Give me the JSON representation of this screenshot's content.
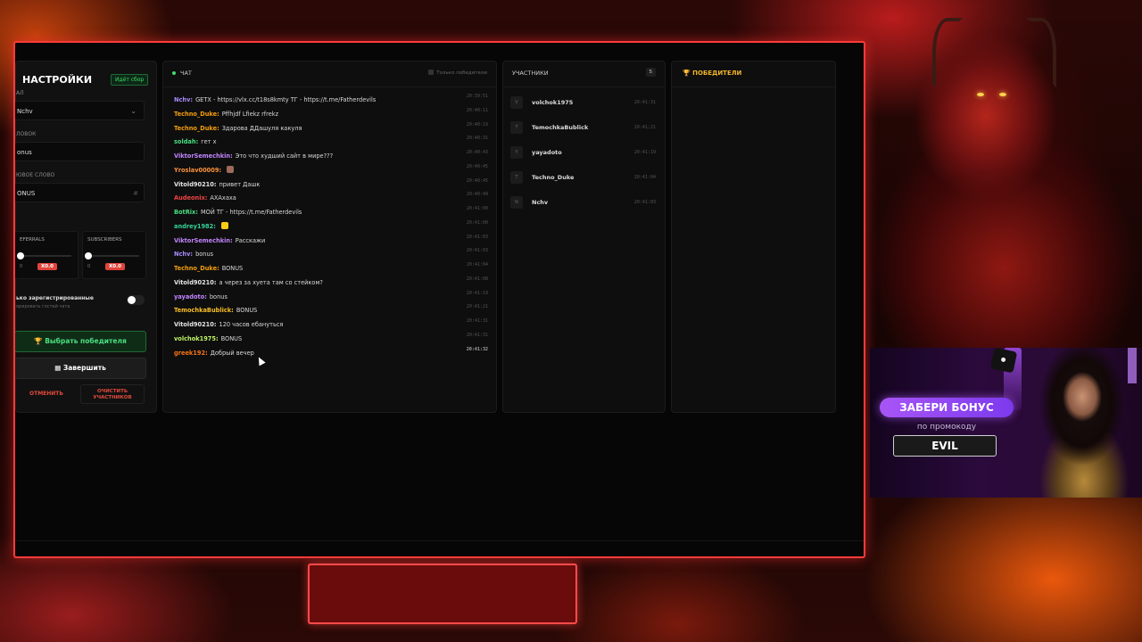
{
  "settings": {
    "title": "НАСТРОЙКИ",
    "collect_badge": "Идёт сбор",
    "channel_label": "АЛ",
    "channel_value": "Nchv",
    "heading_label": "ЛОВОК",
    "heading_value": "onus",
    "keyword_label": "ЮВОЕ СЛОВО",
    "keyword_value": "ONUS",
    "referrals_label": "EFERRALS",
    "referrals_multiplier": "X0.0",
    "subscribers_label": "SUBSCRIBERS",
    "subscribers_multiplier": "X0.0",
    "slider_min": "0",
    "registered_only_label": "ько зарегистрированные",
    "registered_only_sub": "орировать гостей чата",
    "registered_only_on": false,
    "pick_winner_label": "Выбрать победителя",
    "finish_label": "Завершить",
    "cancel_label": "ОТМЕНИТЬ",
    "clear_label": "ОЧИСТИТЬ УЧАСТНИКОВ"
  },
  "chat": {
    "title": "ЧАТ",
    "winners_only_label": "Только победители",
    "messages": [
      {
        "user": "Nchv:",
        "text": "GETX - https://vlx.cc/t18s8kmty ТГ - https://t.me/Fatherdevils",
        "time": "20:39:51",
        "color": "#a78bfa"
      },
      {
        "user": "Techno_Duke:",
        "text": "Pffhjdf Lfiekz rfrekz",
        "time": "20:40:11",
        "color": "#f59e0b"
      },
      {
        "user": "Techno_Duke:",
        "text": "Здарова ДДашуля какуля",
        "time": "20:40:19",
        "color": "#f59e0b"
      },
      {
        "user": "soldah:",
        "text": "гет х",
        "time": "20:40:31",
        "color": "#4ade80"
      },
      {
        "user": "ViktorSemechkin:",
        "text": "Это что худший сайт в мире???",
        "time": "20:40:43",
        "color": "#c084fc"
      },
      {
        "user": "Yroslav00009:",
        "text": "",
        "time": "20:40:45",
        "color": "#fb923c",
        "emoji": true
      },
      {
        "user": "Vitold90210:",
        "text": "привет Дашк",
        "time": "20:40:45",
        "color": "#e5e5e5"
      },
      {
        "user": "Audeonix:",
        "text": "АХАхаха",
        "time": "20:40:49",
        "color": "#ef4444"
      },
      {
        "user": "BotRix:",
        "text": "МОЙ ТГ - https://t.me/Fatherdevils",
        "time": "20:41:00",
        "color": "#4ade80"
      },
      {
        "user": "andrey1982:",
        "text": "",
        "time": "20:41:00",
        "color": "#34d399",
        "emoji": true
      },
      {
        "user": "ViktorSemechkin:",
        "text": "Расскажи",
        "time": "20:41:03",
        "color": "#c084fc"
      },
      {
        "user": "Nchv:",
        "text": "bonus",
        "time": "20:41:03",
        "color": "#a78bfa"
      },
      {
        "user": "Techno_Duke:",
        "text": "BONUS",
        "time": "20:41:04",
        "color": "#f59e0b"
      },
      {
        "user": "Vitold90210:",
        "text": "а через за хуета там со стейком?",
        "time": "20:41:08",
        "color": "#e5e5e5"
      },
      {
        "user": "yayadoto:",
        "text": "bonus",
        "time": "20:41:19",
        "color": "#c084fc"
      },
      {
        "user": "TemochkaBublick:",
        "text": "BONUS",
        "time": "20:41:21",
        "color": "#fbbf24"
      },
      {
        "user": "Vitold90210:",
        "text": "120 часов ебануться",
        "time": "20:41:31",
        "color": "#e5e5e5"
      },
      {
        "user": "volchok1975:",
        "text": "BONUS",
        "time": "20:41:31",
        "color": "#bef264"
      },
      {
        "user": "greek192:",
        "text": "Добрый вечер",
        "time": "20:41:32",
        "color": "#f97316",
        "latest": true
      }
    ]
  },
  "participants": {
    "title": "УЧАСТНИКИ",
    "count": "5",
    "items": [
      {
        "initial": "V",
        "name": "volchok1975",
        "time": "20:41:31"
      },
      {
        "initial": "T",
        "name": "TemochkaBublick",
        "time": "20:41:21"
      },
      {
        "initial": "Y",
        "name": "yayadoto",
        "time": "20:41:19"
      },
      {
        "initial": "T",
        "name": "Techno_Duke",
        "time": "20:41:04"
      },
      {
        "initial": "N",
        "name": "Nchv",
        "time": "20:41:03"
      }
    ]
  },
  "winners": {
    "title": "ПОБЕДИТЕЛИ"
  },
  "promo": {
    "headline": "ЗАБЕРИ БОНУС",
    "subtitle": "по промокоду",
    "code": "EVIL"
  },
  "colors": {
    "frame": "#ff3b3b",
    "accent_green": "#4ade80",
    "danger": "#e24b3c",
    "gold": "#f0b429",
    "promo_purple": "#a855f7"
  }
}
